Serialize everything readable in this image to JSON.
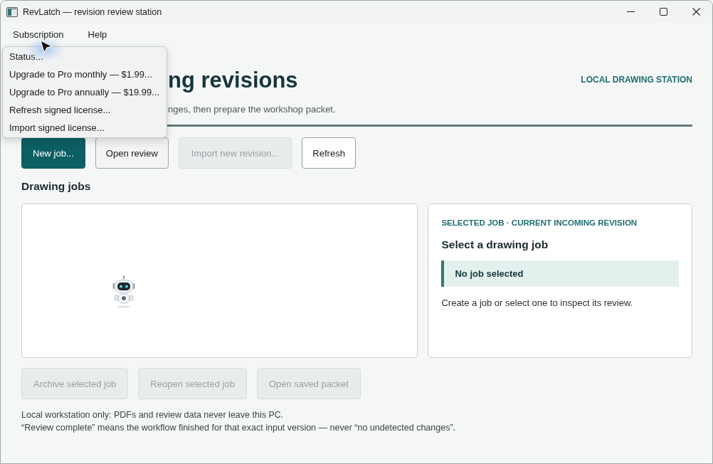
{
  "window": {
    "title": "RevLatch — revision review station"
  },
  "menu_bar": [
    {
      "label": "Subscription"
    },
    {
      "label": "Help"
    }
  ],
  "open_menu": {
    "items": [
      "Status...",
      "Upgrade to Pro monthly — $1.99...",
      "Upgrade to Pro annually — $19.99...",
      "Refresh signed license...",
      "Import signed license..."
    ]
  },
  "header": {
    "title": "ng revisions",
    "subtitle": "nges, then prepare the workshop packet.",
    "tag": "LOCAL DRAWING STATION"
  },
  "actions": [
    {
      "label": "New job...",
      "kind": "primary",
      "disabled": false
    },
    {
      "label": "Open review",
      "kind": "default",
      "disabled": false
    },
    {
      "label": "Import new revision...",
      "kind": "default",
      "disabled": true
    },
    {
      "label": "Refresh",
      "kind": "outline",
      "disabled": false
    }
  ],
  "jobs": {
    "title": "Drawing jobs"
  },
  "detail": {
    "eyebrow": "SELECTED JOB · CURRENT INCOMING REVISION",
    "title": "Select a drawing job",
    "callout": "No job selected",
    "body": "Create a job or select one to inspect its review."
  },
  "job_actions": [
    {
      "label": "Archive selected job",
      "kind": "default",
      "disabled": true
    },
    {
      "label": "Reopen selected job",
      "kind": "default",
      "disabled": true
    },
    {
      "label": "Open saved packet",
      "kind": "default",
      "disabled": true
    }
  ],
  "notes": [
    "Local workstation only: PDFs and review data never leave this PC.",
    "“Review complete” means the workflow finished for that exact input version — never “no undetected changes”."
  ]
}
